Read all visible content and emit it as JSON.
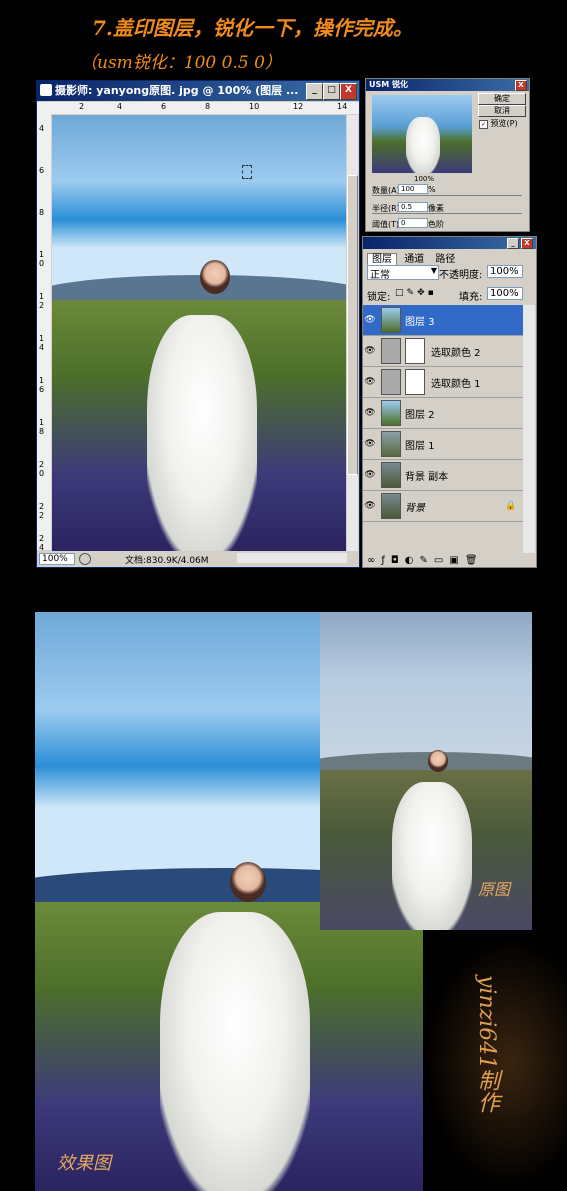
{
  "header": {
    "step_title": "7.盖印图层，锐化一下，操作完成。",
    "sub_title": "（usm锐化：100 0.5 0）"
  },
  "canvas_window": {
    "title": "摄影师: yanyong原图. jpg @ 100% (图层 ...",
    "minimize": "_",
    "maximize": "□",
    "close": "X",
    "ruler_top": [
      "2",
      "4",
      "6",
      "8",
      "10",
      "12",
      "14"
    ],
    "ruler_left": [
      "4",
      "6",
      "8",
      "1 0",
      "1 2",
      "1 4",
      "1 6",
      "1 8",
      "2 0",
      "2 2",
      "2 4"
    ],
    "zoom": "100%",
    "doc_info": "文档:830.9K/4.06M"
  },
  "usm_dialog": {
    "title": "USM 锐化",
    "ok": "确定",
    "cancel": "取消",
    "preview": "预览(P)",
    "zoom": "100%",
    "amount_label": "数量(A):",
    "amount_value": "100",
    "amount_unit": "%",
    "radius_label": "半径(R):",
    "radius_value": "0.5",
    "radius_unit": "像素",
    "threshold_label": "阈值(T):",
    "threshold_value": "0",
    "threshold_unit": "色阶"
  },
  "layers_panel": {
    "tabs": [
      "图层",
      "通道",
      "路径"
    ],
    "blend_mode": "正常",
    "opacity_label": "不透明度:",
    "opacity_value": "100%",
    "lock_label": "锁定:",
    "fill_label": "填充:",
    "fill_value": "100%",
    "layers": [
      {
        "name": "图层 3",
        "selected": true
      },
      {
        "name": "选取颜色 2",
        "adjustment": true
      },
      {
        "name": "选取颜色 1",
        "adjustment": true
      },
      {
        "name": "图层 2"
      },
      {
        "name": "图层 1"
      },
      {
        "name": "背景 副本"
      },
      {
        "name": "背景",
        "locked": true
      }
    ]
  },
  "comparison": {
    "original_label": "原图",
    "result_label": "效果图",
    "watermark": "yinzi641制作"
  },
  "colors": {
    "heading": "#f08a1a",
    "selection": "#3169c6",
    "titlebar": "#0a246a"
  }
}
